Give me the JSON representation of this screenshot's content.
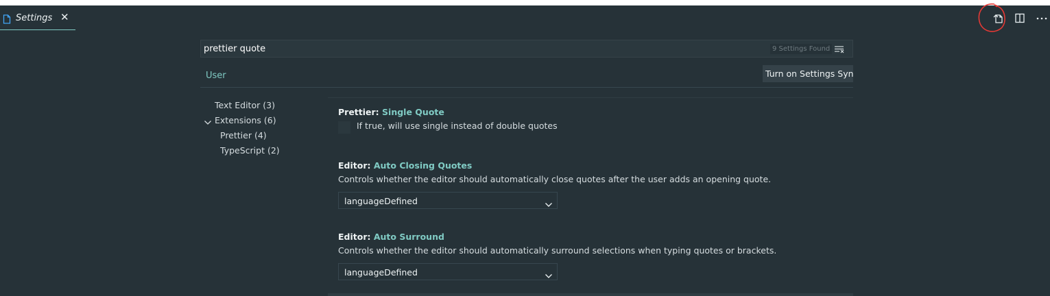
{
  "editor_tab": {
    "title": "Settings",
    "close": "✕"
  },
  "search": {
    "query": "prettier quote",
    "result_count": "9 Settings Found"
  },
  "scope_tabs": {
    "user": "User"
  },
  "sync_button": "Turn on Settings Sync",
  "toc": [
    {
      "label": "Text Editor",
      "count": "(3)"
    },
    {
      "label": "Extensions",
      "count": "(6)"
    },
    {
      "label": "Prettier",
      "count": "(4)"
    },
    {
      "label": "TypeScript",
      "count": "(2)"
    }
  ],
  "settings": [
    {
      "category": "Prettier: ",
      "name": "Single Quote",
      "description": "If true, will use single instead of double quotes",
      "checked": false
    },
    {
      "category": "Editor: ",
      "name": "Auto Closing Quotes",
      "description": "Controls whether the editor should automatically close quotes after the user adds an opening quote.",
      "value": "languageDefined"
    },
    {
      "category": "Editor: ",
      "name": "Auto Surround",
      "description": "Controls whether the editor should automatically surround selections when typing quotes or brackets.",
      "value": "languageDefined"
    }
  ],
  "colors": {
    "background": "#263238",
    "accent": "#80cbc4",
    "annotation": "#e53935"
  }
}
